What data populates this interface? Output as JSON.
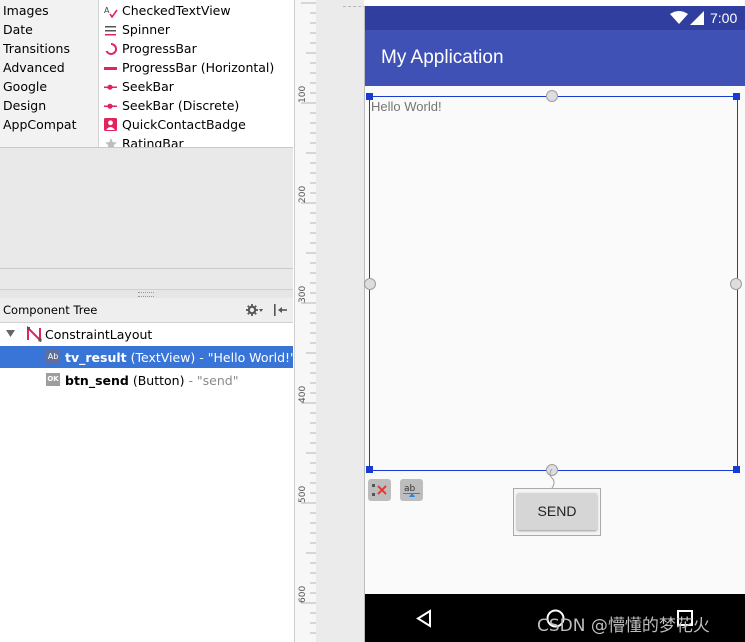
{
  "palette": {
    "categories": [
      "Images",
      "Date",
      "Transitions",
      "Advanced",
      "Google",
      "Design",
      "AppCompat"
    ],
    "widgets": [
      {
        "label": "CheckedTextView",
        "icon": "checked-text-icon"
      },
      {
        "label": "Spinner",
        "icon": "spinner-icon"
      },
      {
        "label": "ProgressBar",
        "icon": "progress-circle-icon"
      },
      {
        "label": "ProgressBar (Horizontal)",
        "icon": "progress-horizontal-icon"
      },
      {
        "label": "SeekBar",
        "icon": "seekbar-icon"
      },
      {
        "label": "SeekBar (Discrete)",
        "icon": "seekbar-discrete-icon"
      },
      {
        "label": "QuickContactBadge",
        "icon": "contact-badge-icon"
      },
      {
        "label": "RatingBar",
        "icon": "star-icon"
      }
    ]
  },
  "component_tree": {
    "title": "Component Tree",
    "root": {
      "label": "ConstraintLayout"
    },
    "children": [
      {
        "id": "tv_result",
        "type": "(TextView)",
        "value": "- \"Hello World!\"",
        "badge": "Ab",
        "selected": true
      },
      {
        "id": "btn_send",
        "type": "(Button)",
        "value": "- \"send\"",
        "badge": "OK",
        "selected": false
      }
    ]
  },
  "ruler": {
    "marks": [
      "100",
      "200",
      "300",
      "400",
      "500",
      "600"
    ]
  },
  "device": {
    "time": "7:00",
    "app_title": "My Application",
    "textview_text": "Hello World!",
    "button_label": "SEND"
  },
  "watermark": "CSDN @懵懂的梦花火",
  "colors": {
    "primary": "#3f51b5",
    "primary_dark": "#303f9f",
    "selection": "#3875d7",
    "constraint_blue": "#1a3ad6"
  }
}
